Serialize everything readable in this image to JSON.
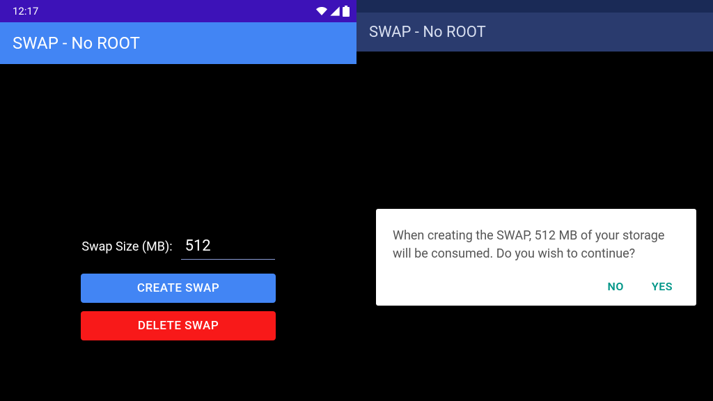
{
  "left": {
    "status": {
      "time": "12:17"
    },
    "app_title": "SWAP - No ROOT",
    "swap_label": "Swap Size (MB):",
    "swap_value": "512",
    "create_button": "CREATE SWAP",
    "delete_button": "DELETE SWAP"
  },
  "right": {
    "app_title": "SWAP - No ROOT",
    "dialog": {
      "message": "When creating the SWAP, 512 MB of your storage will be consumed. Do you wish to continue?",
      "no": "NO",
      "yes": "YES"
    }
  }
}
